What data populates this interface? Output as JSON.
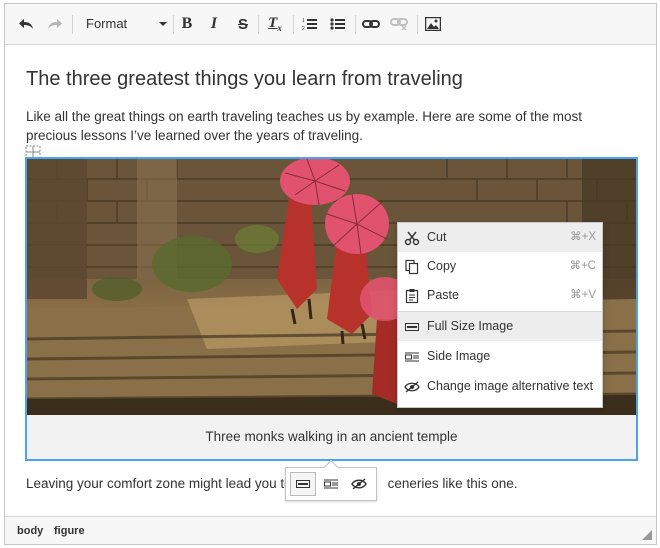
{
  "toolbar": {
    "format_label": "Format",
    "bold_glyph": "B",
    "italic_glyph": "I",
    "strike_glyph": "S",
    "clear_glyph": "T",
    "clear_sub": "x"
  },
  "content": {
    "title": "The three greatest things you learn from traveling",
    "paragraph1": "Like all the great things on earth traveling teaches us by example. Here are some of the most precious lessons I’ve learned over the years of traveling.",
    "caption": "Three monks walking in an ancient temple",
    "paragraph2": "Leaving your comfort zone might lead you to",
    "paragraph2_tail": "ceneries like this one."
  },
  "context_menu": {
    "items": [
      {
        "label": "Cut",
        "shortcut": "⌘+X",
        "icon": "scissors-icon"
      },
      {
        "label": "Copy",
        "shortcut": "⌘+C",
        "icon": "copy-icon"
      },
      {
        "label": "Paste",
        "shortcut": "⌘+V",
        "icon": "paste-icon"
      },
      {
        "label": "Full Size Image",
        "shortcut": "",
        "icon": "full-size-image-icon"
      },
      {
        "label": "Side Image",
        "shortcut": "",
        "icon": "side-image-icon"
      },
      {
        "label": "Change image alternative text",
        "shortcut": "",
        "icon": "alt-text-icon"
      }
    ]
  },
  "status": {
    "crumb1": "body",
    "crumb2": "figure"
  },
  "colors": {
    "selection_border": "#48a3f0",
    "toolbar_bg": "#f7f7f7",
    "umbrella": "#e0526d",
    "robe": "#b8322c"
  }
}
